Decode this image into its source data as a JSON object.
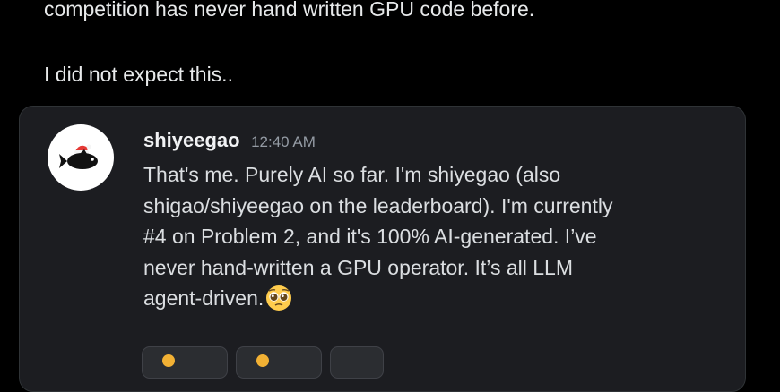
{
  "tweet": {
    "line1": "competition has never hand written GPU code before.",
    "line2": "I did not expect this.."
  },
  "discord_message": {
    "username": "shiyeegao",
    "timestamp": "12:40 AM",
    "avatar_icon": "fish-with-santa-hat-icon",
    "lines": [
      "That's me. Purely AI so far. I'm shiyegao (also",
      "shigao/shiyeegao on the leaderboard). I'm currently",
      "#4 on Problem 2, and it's 100% AI-generated. I’ve",
      "never hand-written a GPU operator. It’s all LLM",
      "agent-driven."
    ],
    "emoji": "pleading-face-emoji"
  },
  "colors": {
    "background": "#000000",
    "card_background": "#1c1d21",
    "text": "#e7e9ea",
    "timestamp": "#949ba4"
  }
}
